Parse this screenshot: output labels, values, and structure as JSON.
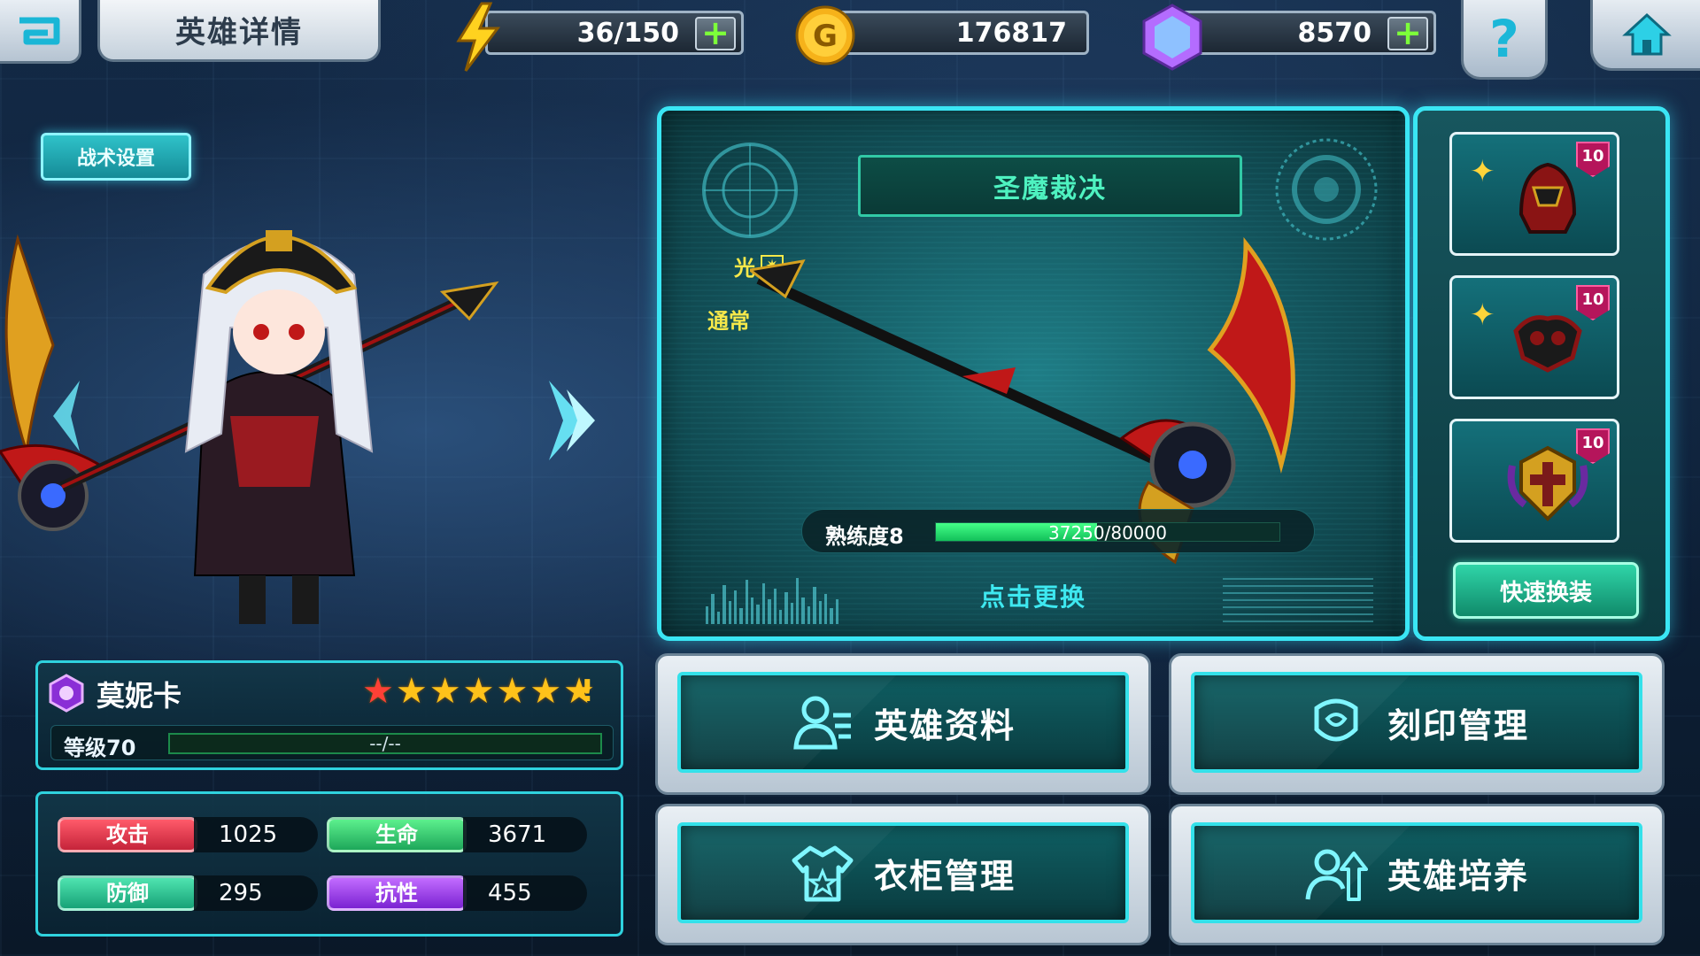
{
  "header": {
    "title": "英雄详情",
    "energy": "36/150",
    "gold": "176817",
    "gems": "8570",
    "help_glyph": "?"
  },
  "left": {
    "tactic_button": "战术设置"
  },
  "hero": {
    "name": "莫妮卡",
    "level_label": "等级70",
    "level_progress": "--/--",
    "stars": 7,
    "alert": "!"
  },
  "stats": {
    "attack_label": "攻击",
    "attack_value": "1025",
    "hp_label": "生命",
    "hp_value": "3671",
    "defense_label": "防御",
    "defense_value": "295",
    "resist_label": "抗性",
    "resist_value": "455"
  },
  "weapon": {
    "name": "圣魔裁决",
    "element": "光",
    "element_glyph": "✷",
    "rarity": "通常",
    "proficiency_label": "熟练度8",
    "proficiency_text": "37250/80000",
    "proficiency_fraction": 0.47,
    "change_label": "点击更换"
  },
  "equipment": {
    "slots": [
      {
        "level": "10",
        "icon": "helmet-icon"
      },
      {
        "level": "10",
        "icon": "armor-icon"
      },
      {
        "level": "10",
        "icon": "emblem-icon"
      }
    ],
    "quick_button": "快速换装"
  },
  "menu": {
    "profile": "英雄资料",
    "engrave": "刻印管理",
    "wardrobe": "衣柜管理",
    "train": "英雄培养"
  },
  "colors": {
    "accent": "#3ae6f4",
    "attack": "#c5243a",
    "hp": "#1ea75a",
    "defense": "#17a277",
    "resist": "#7b22d2",
    "star": "#ffc21a"
  }
}
